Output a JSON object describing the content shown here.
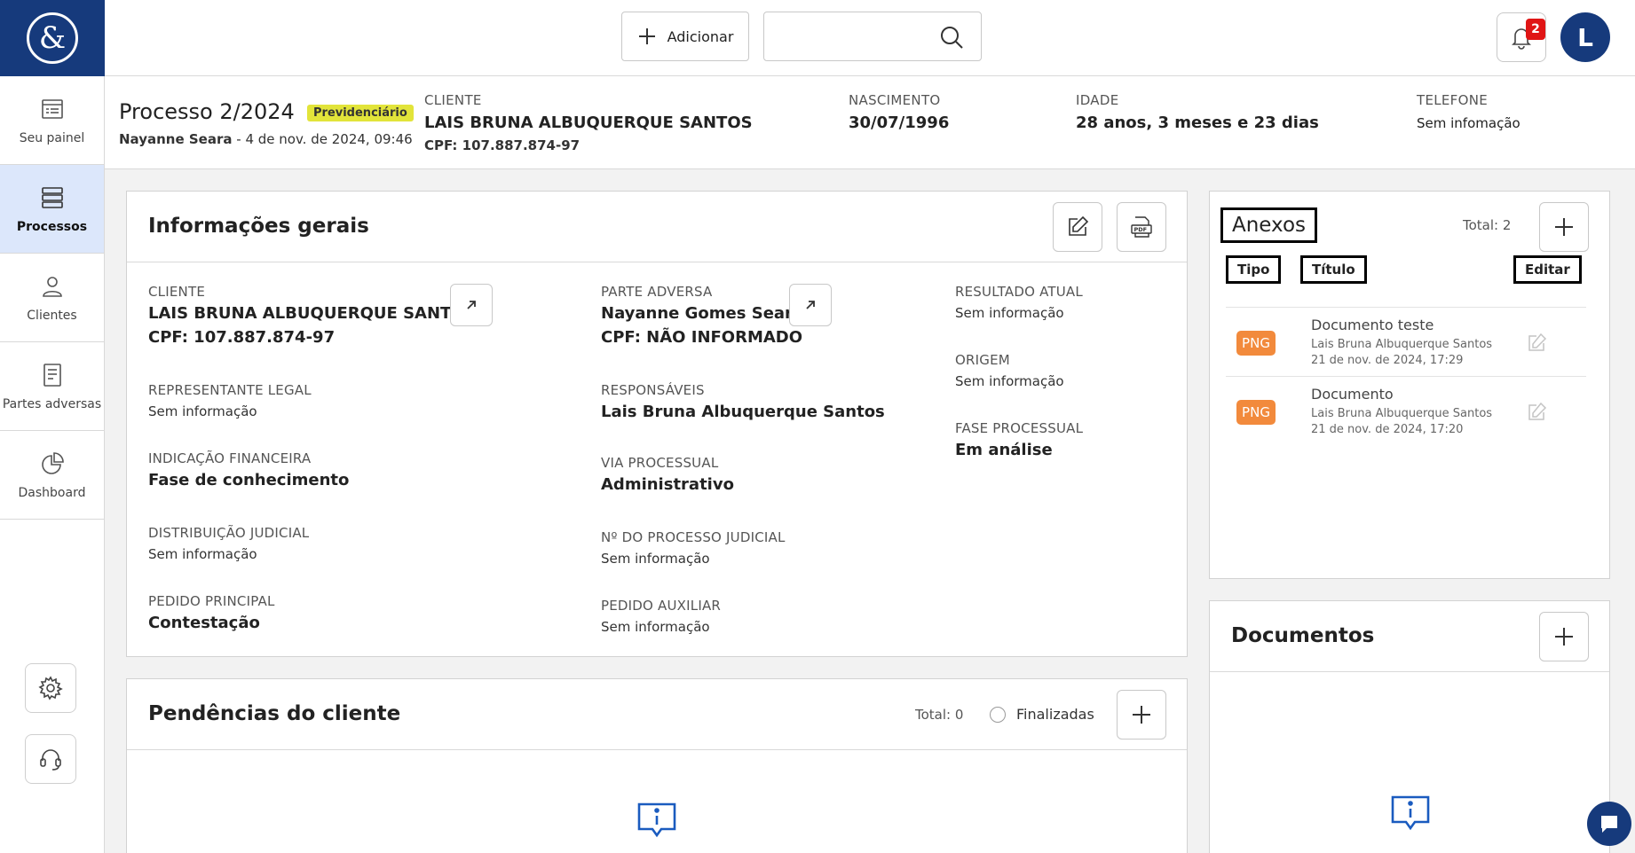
{
  "sidebar": {
    "logo_alt": "&",
    "items": [
      {
        "label": "Seu painel",
        "icon": "dashboard-list-icon"
      },
      {
        "label": "Processos",
        "icon": "stack-icon",
        "active": true
      },
      {
        "label": "Clientes",
        "icon": "user-icon"
      },
      {
        "label": "Partes adversas",
        "icon": "document-icon"
      },
      {
        "label": "Dashboard",
        "icon": "pie-chart-icon"
      }
    ]
  },
  "topbar": {
    "add_label": "Adicionar",
    "search_placeholder": "",
    "notification_count": "2",
    "avatar_initial": "L"
  },
  "header": {
    "process_title": "Processo 2/2024",
    "process_badge": "Previdenciário",
    "author": "Nayanne Seara",
    "date_sep": " - ",
    "created_at": "4 de nov. de 2024, 09:46",
    "client_label": "CLIENTE",
    "client_name": "LAIS BRUNA ALBUQUERQUE SANTOS",
    "client_cpf": "CPF: 107.887.874-97",
    "birth_label": "NASCIMENTO",
    "birth_value": "30/07/1996",
    "age_label": "IDADE",
    "age_value": "28 anos, 3 meses e 23 dias",
    "phone_label": "TELEFONE",
    "phone_value": "Sem infomação"
  },
  "general_info": {
    "title": "Informações gerais",
    "client_label": "CLIENTE",
    "client_name": "LAIS BRUNA ALBUQUERQUE SANTOS",
    "client_cpf": "CPF: 107.887.874-97",
    "legal_rep_label": "REPRESENTANTE LEGAL",
    "legal_rep_value": "Sem informação",
    "financial_label": "INDICAÇÃO FINANCEIRA",
    "financial_value": "Fase de conhecimento",
    "distribution_label": "DISTRIBUIÇÃO JUDICIAL",
    "distribution_value": "Sem informação",
    "main_request_label": "PEDIDO PRINCIPAL",
    "main_request_value": "Contestação",
    "adverse_label": "PARTE ADVERSA",
    "adverse_name": "Nayanne Gomes Seara",
    "adverse_cpf": "CPF: NÃO INFORMADO",
    "responsible_label": "RESPONSÁVEIS",
    "responsible_value": "Lais Bruna Albuquerque Santos",
    "via_label": "VIA PROCESSUAL",
    "via_value": "Administrativo",
    "judicial_number_label": "Nº DO PROCESSO JUDICIAL",
    "judicial_number_value": "Sem informação",
    "aux_request_label": "PEDIDO AUXILIAR",
    "aux_request_value": "Sem informação",
    "current_result_label": "RESULTADO ATUAL",
    "current_result_value": "Sem informação",
    "origin_label": "ORIGEM",
    "origin_value": "Sem informação",
    "phase_label": "FASE PROCESSUAL",
    "phase_value": "Em análise"
  },
  "pending": {
    "title": "Pendências do cliente",
    "total": "Total: 0",
    "finalized_label": "Finalizadas"
  },
  "attachments": {
    "title": "Anexos",
    "total": "Total: 2",
    "col_type": "Tipo",
    "col_title": "Título",
    "col_edit": "Editar",
    "rows": [
      {
        "type": "PNG",
        "title": "Documento teste",
        "author": "Lais Bruna Albuquerque Santos",
        "date": "21 de nov. de 2024, 17:29"
      },
      {
        "type": "PNG",
        "title": "Documento",
        "author": "Lais Bruna Albuquerque Santos",
        "date": "21 de nov. de 2024, 17:20"
      }
    ]
  },
  "documents": {
    "title": "Documentos"
  },
  "colors": {
    "brand": "#163a7c",
    "active_nav": "#dce7fb",
    "badge": "#e2e43a",
    "png_tag": "#f28a3c",
    "notification": "#e01515"
  }
}
